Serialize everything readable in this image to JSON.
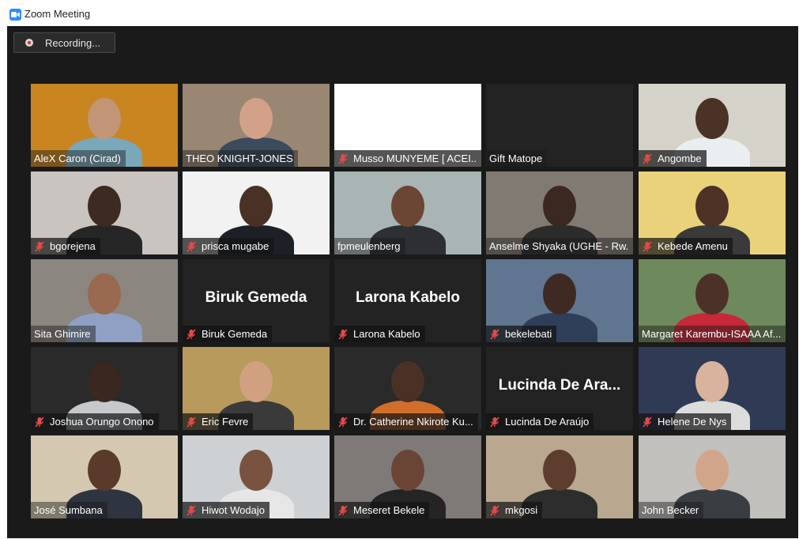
{
  "window": {
    "title": "Zoom Meeting"
  },
  "recording": {
    "label": "Recording..."
  },
  "participants": [
    {
      "name": "AleX Caron (Cirad)",
      "muted": false,
      "video": true,
      "bg": "#c9851f",
      "skin": "#c29577",
      "shirt": "#7aa8bb",
      "active": false
    },
    {
      "name": "THEO KNIGHT-JONES",
      "muted": false,
      "video": true,
      "bg": "#9a8773",
      "skin": "#d3a08a",
      "shirt": "#3b4a5c",
      "active": true
    },
    {
      "name": "Musso MUNYEME [ ACEI...",
      "muted": true,
      "video": false,
      "bg": "#ffffff",
      "active": false
    },
    {
      "name": "Gift Matope",
      "muted": false,
      "video": false,
      "bg": "#232323",
      "active": false
    },
    {
      "name": "Angombe",
      "muted": true,
      "video": true,
      "bg": "#d5d2ca",
      "skin": "#4a3226",
      "shirt": "#e9eef0",
      "active": false
    },
    {
      "name": "bgorejena",
      "muted": true,
      "video": true,
      "bg": "#c9c4bf",
      "skin": "#3d2a20",
      "shirt": "#262626",
      "active": false
    },
    {
      "name": "prisca mugabe",
      "muted": true,
      "video": true,
      "bg": "#f2f2f2",
      "skin": "#4a3125",
      "shirt": "#1e2028",
      "active": false
    },
    {
      "name": "fpmeulenberg",
      "muted": false,
      "video": true,
      "bg": "#a9b5b4",
      "skin": "#6c4634",
      "shirt": "#2d2f33",
      "active": false
    },
    {
      "name": "Anselme Shyaka (UGHE - Rw...",
      "muted": false,
      "video": true,
      "bg": "#817a72",
      "skin": "#3b2820",
      "shirt": "#2c2c2c",
      "active": false
    },
    {
      "name": "Kebede Amenu",
      "muted": true,
      "video": true,
      "bg": "#e9d27a",
      "skin": "#4e3226",
      "shirt": "#3a3a3a",
      "active": false
    },
    {
      "name": "Sita Ghimire",
      "muted": false,
      "video": true,
      "bg": "#8c8680",
      "skin": "#9a6a50",
      "shirt": "#8fa0c4",
      "active": false
    },
    {
      "name": "Biruk Gemeda",
      "muted": true,
      "video": false,
      "bg": "#232323",
      "active": false
    },
    {
      "name": "Larona Kabelo",
      "muted": true,
      "video": false,
      "bg": "#232323",
      "active": false
    },
    {
      "name": "bekelebati",
      "muted": true,
      "video": true,
      "bg": "#5f7590",
      "skin": "#3e2a22",
      "shirt": "#2f3f5a",
      "active": false
    },
    {
      "name": "Margaret Karembu-ISAAA Af...",
      "muted": false,
      "video": true,
      "bg": "#6e8a5c",
      "skin": "#4b3127",
      "shirt": "#c7283a",
      "active": false
    },
    {
      "name": "Joshua Orungo Onono",
      "muted": true,
      "video": true,
      "bg": "#2a2a2a",
      "skin": "#3a271f",
      "shirt": "#c5c9cc",
      "active": false
    },
    {
      "name": "Eric Fevre",
      "muted": true,
      "video": true,
      "bg": "#b89a5c",
      "skin": "#d0a080",
      "shirt": "#3a3a3a",
      "active": false
    },
    {
      "name": "Dr. Catherine Nkirote Ku...",
      "muted": true,
      "video": true,
      "bg": "#2a2a2a",
      "skin": "#4a3025",
      "shirt": "#d26e2c",
      "active": false
    },
    {
      "name": "Lucinda De Araújo",
      "muted": true,
      "video": false,
      "bg": "#232323",
      "active": false
    },
    {
      "name": "Helene De Nys",
      "muted": true,
      "video": true,
      "bg": "#2f3a55",
      "skin": "#d9b39c",
      "shirt": "#dcdcdc",
      "active": false
    },
    {
      "name": "José Sumbana",
      "muted": false,
      "video": true,
      "bg": "#d4c8b0",
      "skin": "#5a3b2b",
      "shirt": "#2e3440",
      "active": false
    },
    {
      "name": "Hiwot Wodajo",
      "muted": true,
      "video": true,
      "bg": "#cdd1d3",
      "skin": "#7a5240",
      "shirt": "#e6e6e6",
      "active": false
    },
    {
      "name": "Meseret Bekele",
      "muted": true,
      "video": true,
      "bg": "#7f7a78",
      "skin": "#6a4535",
      "shirt": "#242424",
      "active": false
    },
    {
      "name": "mkgosi",
      "muted": true,
      "video": true,
      "bg": "#b9a78f",
      "skin": "#5c3d2e",
      "shirt": "#2d2d2d",
      "active": false
    },
    {
      "name": "John Becker",
      "muted": false,
      "video": true,
      "bg": "#c2c0bc",
      "skin": "#d1a58a",
      "shirt": "#3a3d42",
      "active": false
    }
  ],
  "placeholders": {
    "11": "Biruk Gemeda",
    "12": "Larona Kabelo",
    "18": "Lucinda De Ara..."
  }
}
